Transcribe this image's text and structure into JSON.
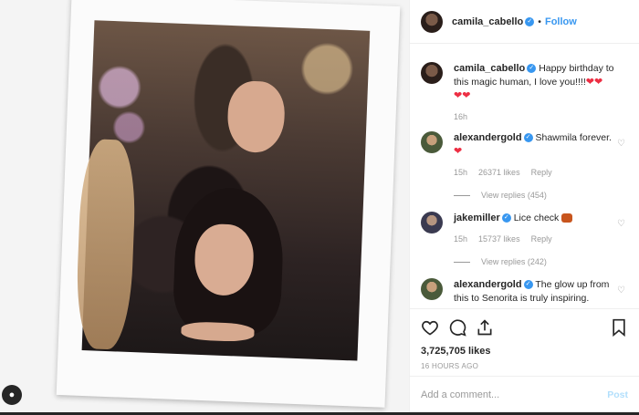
{
  "header": {
    "username": "camila_cabello",
    "follow_label": "Follow",
    "dot": "•"
  },
  "caption": {
    "username": "camila_cabello",
    "text": "Happy birthday to this magic human, I love you!!!!",
    "time": "16h"
  },
  "comments": [
    {
      "username": "alexandergold",
      "text": "Shawmila forever.",
      "time": "15h",
      "likes": "26371 likes",
      "reply_label": "Reply",
      "view_replies": "View replies (454)"
    },
    {
      "username": "jakemiller",
      "text": "Lice check",
      "time": "15h",
      "likes": "15737 likes",
      "reply_label": "Reply",
      "view_replies": "View replies (242)"
    },
    {
      "username": "alexandergold",
      "text": "The glow up from this to Senorita is truly inspiring."
    }
  ],
  "post": {
    "likes": "3,725,705 likes",
    "posted_ago": "16 HOURS AGO"
  },
  "comment_box": {
    "placeholder": "Add a comment...",
    "post_label": "Post"
  },
  "icons": {
    "like": "heart-icon",
    "comment": "comment-icon",
    "share": "share-icon",
    "save": "bookmark-icon"
  },
  "colors": {
    "accent": "#3897f0",
    "heart": "#ed2e43",
    "muted": "#999999"
  }
}
